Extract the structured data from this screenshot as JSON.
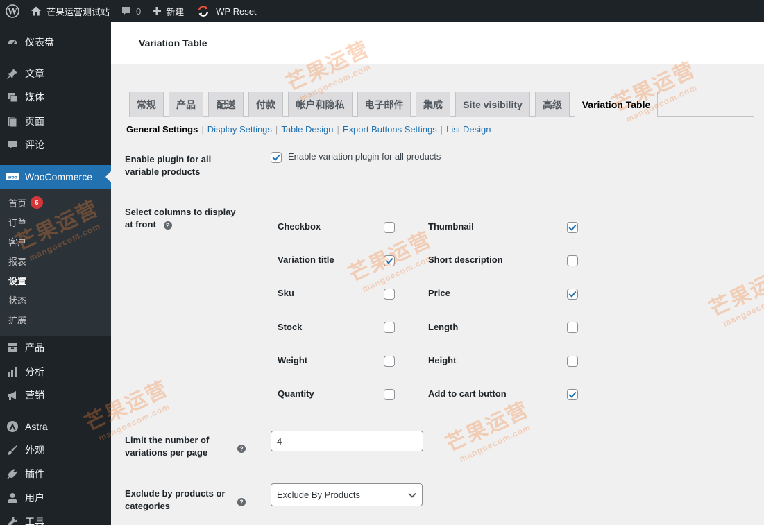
{
  "admin_bar": {
    "site_name": "芒果运营测试站",
    "comments_count": "0",
    "new_label": "新建",
    "wp_reset_label": "WP Reset"
  },
  "sidebar": {
    "items": [
      {
        "label": "仪表盘",
        "icon": "dashboard-icon"
      },
      {
        "label": "文章",
        "icon": "pin-icon"
      },
      {
        "label": "媒体",
        "icon": "media-icon"
      },
      {
        "label": "页面",
        "icon": "page-icon"
      },
      {
        "label": "评论",
        "icon": "comment-icon"
      },
      {
        "label": "WooCommerce",
        "icon": "woo-icon"
      },
      {
        "label": "产品",
        "icon": "archive-icon"
      },
      {
        "label": "分析",
        "icon": "bar-chart-icon"
      },
      {
        "label": "营销",
        "icon": "megaphone-icon"
      },
      {
        "label": "Astra",
        "icon": "astra-icon"
      },
      {
        "label": "外观",
        "icon": "brush-icon"
      },
      {
        "label": "插件",
        "icon": "plug-icon"
      },
      {
        "label": "用户",
        "icon": "user-icon"
      },
      {
        "label": "工具",
        "icon": "wrench-icon"
      }
    ],
    "submenu": [
      {
        "label": "首页",
        "badge": "6"
      },
      {
        "label": "订单"
      },
      {
        "label": "客户"
      },
      {
        "label": "报表"
      },
      {
        "label": "设置"
      },
      {
        "label": "状态"
      },
      {
        "label": "扩展"
      }
    ]
  },
  "page": {
    "title": "Variation Table"
  },
  "tabs": [
    "常规",
    "产品",
    "配送",
    "付款",
    "帐户和隐私",
    "电子邮件",
    "集成",
    "Site visibility",
    "高级",
    "Variation Table"
  ],
  "subnav": [
    "General Settings",
    "Display Settings",
    "Table Design",
    "Export Buttons Settings",
    "List Design"
  ],
  "settings": {
    "enable_label_1": "Enable plugin for all",
    "enable_label_2": "variable products",
    "enable_checkbox_label": "Enable variation plugin for all products",
    "enable_checked": true,
    "columns_label_1": "Select columns to display",
    "columns_label_2": "at front",
    "help_glyph": "?",
    "columns": [
      {
        "label": "Checkbox",
        "checked": false
      },
      {
        "label": "Thumbnail",
        "checked": true
      },
      {
        "label": "Variation title",
        "checked": true
      },
      {
        "label": "Short description",
        "checked": false
      },
      {
        "label": "Sku",
        "checked": false
      },
      {
        "label": "Price",
        "checked": true
      },
      {
        "label": "Stock",
        "checked": false
      },
      {
        "label": "Length",
        "checked": false
      },
      {
        "label": "Weight",
        "checked": false
      },
      {
        "label": "Height",
        "checked": false
      },
      {
        "label": "Quantity",
        "checked": false
      },
      {
        "label": "Add to cart button",
        "checked": true
      }
    ],
    "limit_label_1": "Limit the number of",
    "limit_label_2": "variations per page",
    "limit_value": "4",
    "exclude_label_1": "Exclude by products or",
    "exclude_label_2": "categories",
    "exclude_selected": "Exclude By Products"
  },
  "watermark": {
    "text": "芒果运营",
    "url": "mangoecom.com"
  },
  "colors": {
    "admin_bg": "#1d2327",
    "accent": "#2271b1",
    "badge": "#d63638"
  }
}
